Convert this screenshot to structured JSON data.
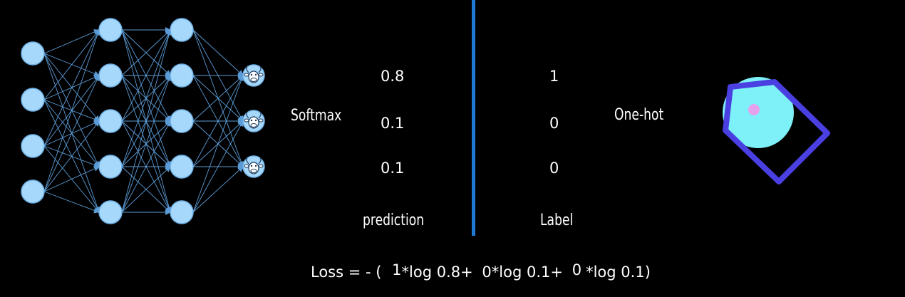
{
  "colors": {
    "background": "#000000",
    "neuron": "#a6d8fb",
    "neuron_stroke": "#6eb0e6",
    "edge": "#5b9bd5",
    "divider": "#1f7ad6",
    "text": "#ffffff",
    "target_circle": "#7ef0f8",
    "target_dot": "#e4a2ee",
    "target_frame": "#4a3fe0"
  },
  "network": {
    "layer_sizes": [
      4,
      5,
      5,
      3
    ],
    "output_icons": [
      "cow-face-icon",
      "cow-face-icon",
      "cow-face-icon"
    ]
  },
  "softmax_label": "Softmax",
  "prediction": {
    "values": [
      "0.8",
      "0.1",
      "0.1"
    ],
    "caption": "prediction"
  },
  "label": {
    "values": [
      "1",
      "0",
      "0"
    ],
    "caption": "Label"
  },
  "onehot_label": "One-hot",
  "loss": {
    "prefix": "Loss = - (",
    "terms": [
      {
        "coef": "1",
        "op": "*log",
        "arg": "0.8",
        "sep": "+"
      },
      {
        "coef": "0",
        "op": "*log",
        "arg": "0.1",
        "sep": "+"
      },
      {
        "coef": "0",
        "op": "*log",
        "arg": "0.1",
        "sep": ")"
      }
    ]
  }
}
